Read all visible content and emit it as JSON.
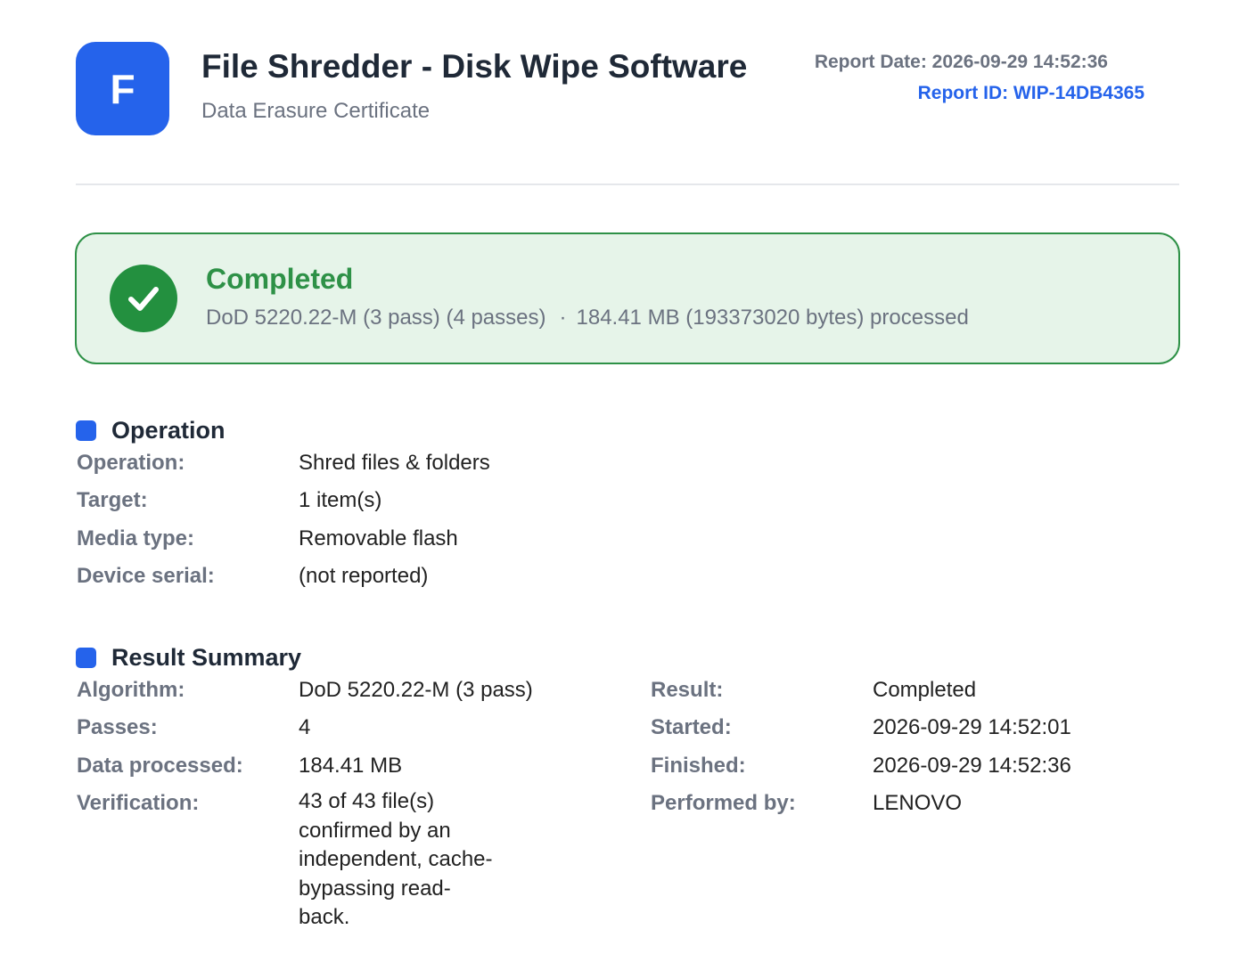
{
  "header": {
    "logo_letter": "F",
    "title": "File Shredder - Disk Wipe Software",
    "subtitle": "Data Erasure Certificate",
    "report_date": "Report Date: 2026-09-29 14:52:36",
    "report_id": "Report ID: WIP-14DB4365"
  },
  "status": {
    "icon": "check-circle-icon",
    "title": "Completed",
    "method": "DoD 5220.22-M (3 pass) (4 passes)",
    "separator": "·",
    "processed": "184.41 MB (193373020 bytes) processed"
  },
  "operation": {
    "heading": "Operation",
    "rows": [
      {
        "label": "Operation:",
        "value": "Shred files & folders"
      },
      {
        "label": "Target:",
        "value": "1 item(s)"
      },
      {
        "label": "Media type:",
        "value": "Removable flash"
      },
      {
        "label": "Device serial:",
        "value": "(not reported)"
      }
    ]
  },
  "result_summary": {
    "heading": "Result Summary",
    "left": [
      {
        "label": "Algorithm:",
        "value": "DoD 5220.22-M (3 pass)"
      },
      {
        "label": "Passes:",
        "value": "4"
      },
      {
        "label": "Data processed:",
        "value": "184.41 MB"
      },
      {
        "label": "Verification:",
        "value": "43 of 43 file(s) confirmed by an independent, cache-bypassing read-back."
      }
    ],
    "right": [
      {
        "label": "Result:",
        "value": "Completed"
      },
      {
        "label": "Started:",
        "value": "2026-09-29 14:52:01"
      },
      {
        "label": "Finished:",
        "value": "2026-09-29 14:52:36"
      },
      {
        "label": "Performed by:",
        "value": "LENOVO"
      }
    ]
  },
  "colors": {
    "accent": "#2563eb",
    "success": "#2e9147",
    "success_bg": "#e6f4e9"
  }
}
